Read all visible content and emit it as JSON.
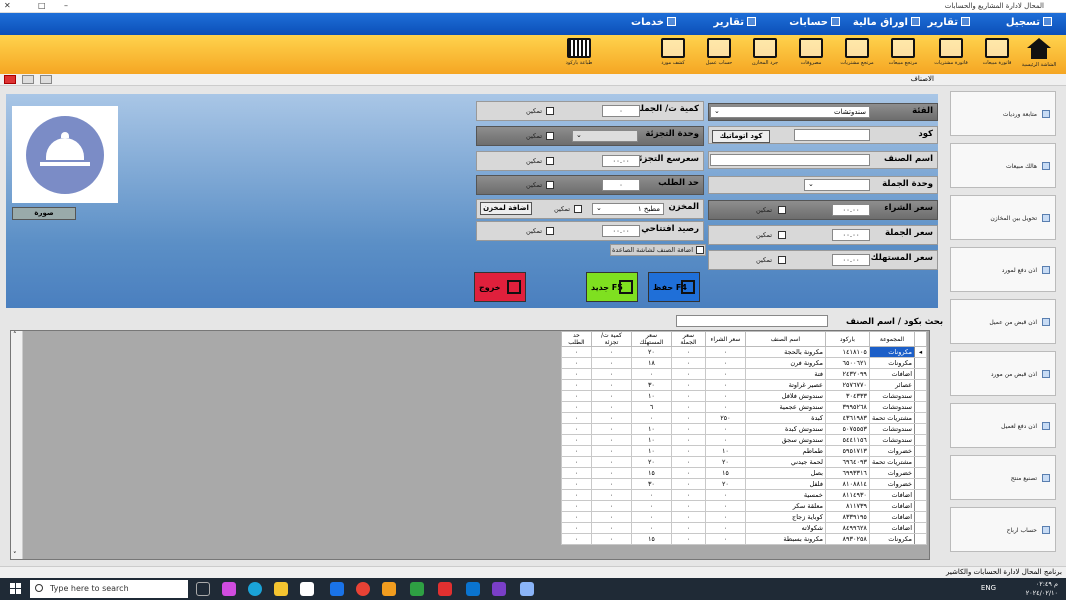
{
  "window": {
    "title": "المحال لادارة المشاريع والحسابات"
  },
  "menu": {
    "items": [
      "تسجيل",
      "تقارير",
      "اوراق مالية",
      "حسابات",
      "تقارير",
      "خدمات"
    ]
  },
  "ribbon": {
    "buttons": [
      "الشاشة الرئيسية",
      "فاتورة مبيعات",
      "فاتورة مشتريات",
      "مرتجع مبيعات",
      "مرتجع مشتريات",
      "مصروفات",
      "جرد المخازن",
      "حساب عميل",
      "كشف مورد",
      "طباعة باركود"
    ]
  },
  "tab": {
    "title": "الاصناف"
  },
  "form": {
    "category_label": "الفئة",
    "category_value": "سندوتشات",
    "code_label": "كود",
    "auto_code": "كود اتوماتيك",
    "name_label": "اسم الصنف",
    "wholesale_unit_label": "وحدة الجملة",
    "buy_price_label": "سعر الشراء",
    "buy_price_value": "٠٠.٠٠",
    "wholesale_price_label": "سعر الجملة",
    "wholesale_price_value": "٠٠.٠٠",
    "consumer_price_label": "سعر المستهلك",
    "consumer_price_value": "٠٠.٠٠",
    "qty_per_wholesale_label": "كمية ت/ الجملة",
    "qty_per_wholesale_value": "٠",
    "retail_unit_label": "وحدة التجزئة",
    "retail_price_label": "سعرسع التجزئة",
    "retail_price_value": "٠٠.٠٠",
    "order_limit_label": "حد الطلب",
    "order_limit_value": "٠",
    "store_label": "المخزن",
    "store_value": "مطبخ ١",
    "add_to_store": "اضافة لمخزن",
    "opening_balance_label": "رصيد افتتاحي",
    "opening_balance_value": "٠٠.٠٠",
    "enable": "تمكين",
    "add_to_touch": "اضافة الصنف لشاشة الصاعدة",
    "image_btn": "صورة"
  },
  "actions": {
    "save": "حفظ F4",
    "new": "جديد F5",
    "exit": "خروج"
  },
  "colors": {
    "save": "#1f6fd8",
    "new": "#7fe020",
    "exit": "#e0203c"
  },
  "sidebar": {
    "items": [
      "متابعة ورديات",
      "هالك مبيعات",
      "تحويل بين المخازن",
      "اذن دفع لمورد",
      "اذن قبض من عميل",
      "اذن قبض من مورد",
      "اذن دفع لعميل",
      "تصنيع منتج",
      "حساب ارباح"
    ]
  },
  "search": {
    "label": "بحث بكود / اسم الصنف"
  },
  "grid": {
    "columns": [
      "المجموعة",
      "باركود",
      "اسم الصنف",
      "سعر الشراء",
      "سعر الجملة",
      "سعر المستهلك",
      "كمية ت/ تجزئة",
      "حد الطلب"
    ],
    "rows": [
      [
        "مكرونات",
        "١٤١٨١٠٥",
        "مكرونة بالحجة",
        "٠",
        "٠",
        "٢٠",
        "٠",
        "٠"
      ],
      [
        "مكرونات",
        "٦٥٠٠٦٢١",
        "مكرونة فرن",
        "٠",
        "٠",
        "١٨",
        "٠",
        "٠"
      ],
      [
        "اضافات",
        "٢٤٣٢٠٩٩",
        "فتة",
        "٠",
        "٠",
        "٠",
        "٠",
        "٠"
      ],
      [
        "عصائر",
        "٢٥٧٦٧٧٠",
        "عصير غراوتة",
        "٠",
        "٠",
        "٣٠",
        "٠",
        "٠"
      ],
      [
        "سندوتشات",
        "٣٠٤٣٣٣",
        "سندوتش فلافل",
        "٠",
        "٠",
        "١٠",
        "٠",
        "٠"
      ],
      [
        "سندوتشات",
        "٣٩٩٥٢٦٨",
        "سندوتش عجمية",
        "٠",
        "٠",
        "٦",
        "٠",
        "٠"
      ],
      [
        "مشتريات تحمة",
        "٤٣٦١٩٨٣",
        "كبدة",
        "٢٥٠",
        "٠",
        "٠",
        "٠",
        "٠"
      ],
      [
        "سندوتشات",
        "٥٠٧٥٥٥٣",
        "سندوتش كبدة",
        "٠",
        "٠",
        "١٠",
        "٠",
        "٠"
      ],
      [
        "سندوتشات",
        "٥٤٤١١٥٦",
        "سندوتش سجق",
        "٠",
        "٠",
        "١٠",
        "٠",
        "٠"
      ],
      [
        "خضروات",
        "٥٩٥١٧١٣",
        "طماطم",
        "١٠",
        "٠",
        "١٠",
        "٠",
        "٠"
      ],
      [
        "مشتريات تحمة",
        "٦٩٦٤٠٩٣",
        "لحمة جيدني",
        "٢٠",
        "٠",
        "٢٠",
        "٠",
        "٠"
      ],
      [
        "خضروات",
        "٦٩٩٣٣١٦",
        "بصل",
        "١٥",
        "٠",
        "١٥",
        "٠",
        "٠"
      ],
      [
        "خضروات",
        "٨١٠٨٨١٤",
        "فلفل",
        "٢٠",
        "٠",
        "٣٠",
        "٠",
        "٠"
      ],
      [
        "اضافات",
        "٨١١٤٩٣٠",
        "خمسية",
        "٠",
        "٠",
        "٠",
        "٠",
        "٠"
      ],
      [
        "اضافات",
        "٨١١٧٣٩",
        "معلقة سكر",
        "٠",
        "٠",
        "٠",
        "٠",
        "٠"
      ],
      [
        "اضافات",
        "٨٣٣٩١٩٥",
        "كوباية زجاج",
        "٠",
        "٠",
        "٠",
        "٠",
        "٠"
      ],
      [
        "اضافات",
        "٨٤٩٩٦٢٨",
        "شكولاته",
        "٠",
        "٠",
        "٠",
        "٠",
        "٠"
      ],
      [
        "مكرونات",
        "٨٩٣٠٢٥٨",
        "مكرونة بسبطة",
        "٠",
        "٠",
        "١٥",
        "٠",
        "٠"
      ]
    ]
  },
  "statusbar": {
    "text": "برنامج المحال لادارة الحسابات والكاشير"
  },
  "taskbar": {
    "search_placeholder": "Type here to search",
    "lang": "ENG",
    "time": "م ٠٢:٤٩",
    "date": "٢٠٢٤/٠٢/١٠"
  }
}
